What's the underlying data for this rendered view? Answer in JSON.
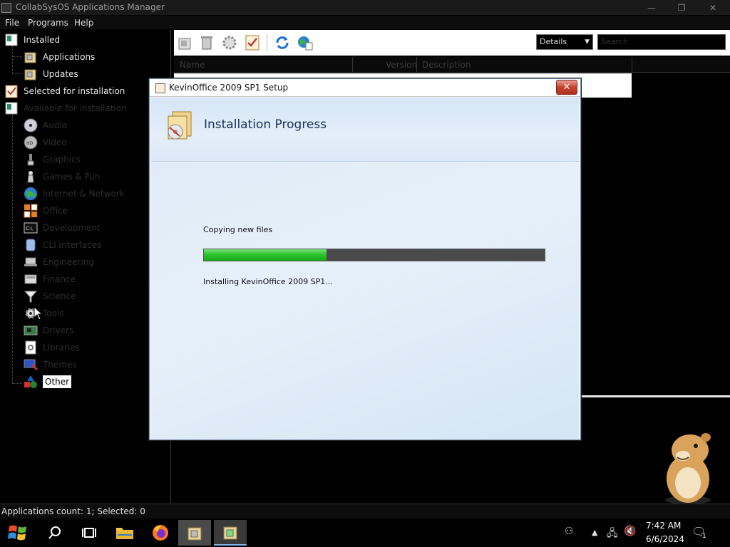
{
  "window": {
    "title": "CollabSysOS Applications Manager",
    "buttons": [
      "—",
      "❐",
      "✕"
    ]
  },
  "menu": [
    "File",
    "Programs",
    "Help"
  ],
  "tree": {
    "installed": "Installed",
    "applications": "Applications",
    "updates": "Updates",
    "selected": "Selected for installation",
    "available": "Available for installation",
    "categories": [
      "Audio",
      "Video",
      "Graphics",
      "Games & Fun",
      "Internet & Network",
      "Office",
      "Development",
      "CLI Interfaces",
      "Engineering",
      "Finance",
      "Science",
      "Tools",
      "Drivers",
      "Libraries",
      "Themes",
      "Other"
    ]
  },
  "toolbar": {
    "view_mode": "Details",
    "search_placeholder": "Search"
  },
  "list": {
    "columns": [
      "Name",
      "Version",
      "Description"
    ]
  },
  "status": "Applications count: 1; Selected: 0",
  "dialog": {
    "title": "KevinOffice 2009 SP1 Setup",
    "close": "✕",
    "heading": "Installation Progress",
    "status_text": "Copying new files",
    "progress": 0.36,
    "detail_text": "Installing KevinOffice 2009 SP1..."
  },
  "taskbar": {
    "time": "7:42 AM",
    "date": "6/6/2024",
    "notification_count": "1"
  },
  "colors": {
    "progress_fill": "#2ec42e",
    "progress_track": "#4a4a4a",
    "banner": "#d6e6f6"
  }
}
